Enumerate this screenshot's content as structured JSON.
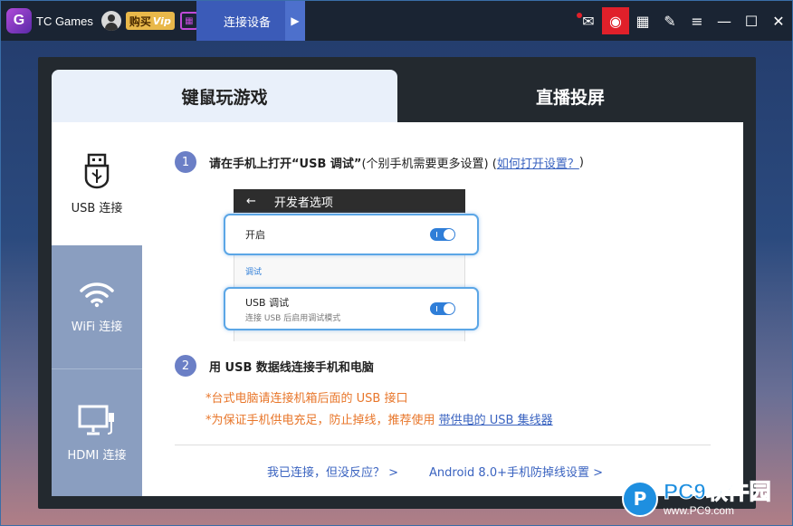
{
  "titlebar": {
    "logo_text": "G",
    "app_name": "TC Games",
    "buy_label": "购买",
    "vip_label": "Vip",
    "active_tab": "连接设备",
    "tab_arrow": "▶",
    "icons": {
      "message": "✉",
      "monitor": "◉",
      "layout": "▦",
      "pin": "✎",
      "menu": "≡",
      "minimize": "—",
      "maximize": "☐",
      "close": "✕"
    }
  },
  "tabs": {
    "mouse": "键鼠玩游戏",
    "live": "直播投屏"
  },
  "sidebar": {
    "usb": "USB 连接",
    "wifi": "WiFi 连接",
    "hdmi": "HDMI 连接"
  },
  "step1": {
    "num": "1",
    "text": "请在手机上打开“USB 调试”",
    "hint": "(个别手机需要更多设置) (",
    "link": "如何打开设置？",
    "end": ")"
  },
  "phone": {
    "back": "←",
    "title": "开发者选项",
    "open_label": "开启",
    "section": "调试",
    "usb_debug": "USB 调试",
    "usb_debug_sub": "连接 USB 后启用调试模式"
  },
  "step2": {
    "num": "2",
    "text": "用 USB 数据线连接手机和电脑"
  },
  "notes": {
    "line1": "*台式电脑请连接机箱后面的 USB 接口",
    "line2_prefix": "*为保证手机供电充足，防止掉线，推荐使用",
    "line2_link": "带供电的 USB 集线器"
  },
  "bottom_links": {
    "no_response": "我已连接，但没反应？ >",
    "android": "Android 8.0+手机防掉线设置 >"
  },
  "watermark": {
    "logo": "P",
    "title": "PC9软件园",
    "url": "www.PC9.com"
  }
}
